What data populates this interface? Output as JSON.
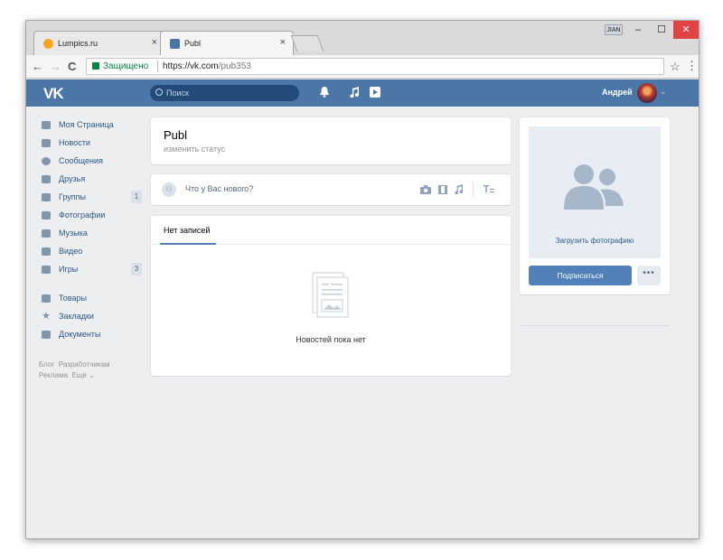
{
  "browser": {
    "tabs": [
      {
        "title": "Lumpics.ru",
        "close": "×"
      },
      {
        "title": "Publ",
        "close": "×"
      }
    ],
    "profile_label": "JIAN",
    "window_controls": {
      "minimize": "–",
      "maximize": "☐",
      "close": "✕"
    },
    "secure_label": "Защищено",
    "url_host": "https://vk.com",
    "url_path": "/pub353",
    "nav_back": "←",
    "nav_forward": "→",
    "nav_reload": "C",
    "bookmark_star": "☆",
    "menu": "⋮"
  },
  "vk": {
    "logo": "VK",
    "search_placeholder": "Поиск",
    "user_name": "Андрей",
    "icons": {
      "bell": "bell-icon",
      "music": "music-icon",
      "video": "video-icon"
    },
    "sidebar": {
      "items": [
        {
          "label": "Моя Страница",
          "icon": "home-icon"
        },
        {
          "label": "Новости",
          "icon": "news-icon"
        },
        {
          "label": "Сообщения",
          "icon": "messages-icon"
        },
        {
          "label": "Друзья",
          "icon": "friends-icon"
        },
        {
          "label": "Группы",
          "icon": "groups-icon",
          "badge": "1"
        },
        {
          "label": "Фотографии",
          "icon": "camera-icon"
        },
        {
          "label": "Музыка",
          "icon": "music-icon"
        },
        {
          "label": "Видео",
          "icon": "film-icon"
        },
        {
          "label": "Игры",
          "icon": "gamepad-icon",
          "badge": "3"
        }
      ],
      "items2": [
        {
          "label": "Товары",
          "icon": "bag-icon"
        },
        {
          "label": "Закладки",
          "icon": "star-icon"
        },
        {
          "label": "Документы",
          "icon": "document-icon"
        }
      ],
      "footer": {
        "blog": "Блог",
        "developers": "Разработчикам",
        "ads": "Реклама",
        "more": "Ещё ⌄"
      }
    },
    "page": {
      "title": "Publ",
      "status": "изменить статус",
      "composer_placeholder": "Что у Вас нового?",
      "tab_label": "Нет записей",
      "empty_text": "Новостей пока нет"
    },
    "right": {
      "upload_photo": "Загрузить фотографию",
      "subscribe": "Подписаться",
      "more": "•••"
    }
  },
  "colors": {
    "vk_header": "#4a76a8",
    "vk_link": "#2a5885",
    "vk_button": "#5181b8",
    "page_bg": "#edeef0"
  }
}
